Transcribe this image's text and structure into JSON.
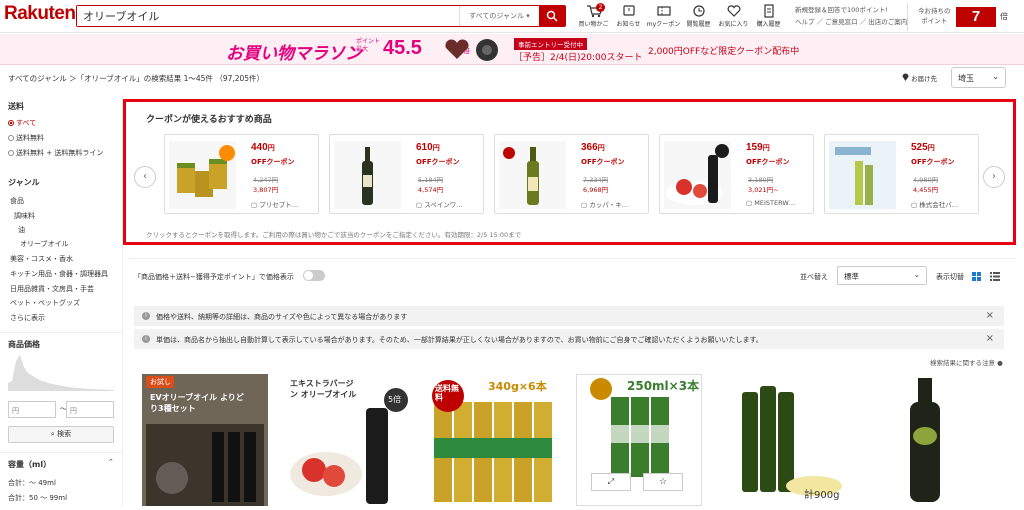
{
  "header": {
    "logo": "Rakuten",
    "search_value": "オリーブオイル",
    "genre_label": "すべてのジャンル",
    "icons": [
      {
        "label": "買い物かご",
        "name": "cart-icon",
        "badge": "2"
      },
      {
        "label": "お知らせ",
        "name": "bell-icon"
      },
      {
        "label": "myクーポン",
        "name": "coupon-icon"
      },
      {
        "label": "閲覧履歴",
        "name": "history-icon"
      },
      {
        "label": "お気に入り",
        "name": "heart-icon"
      },
      {
        "label": "購入履歴",
        "name": "receipt-icon"
      }
    ],
    "links_line1": "新規登録＆回答で100ポイント!",
    "links_line2": "ヘルプ ／ ご意見窓口 ／ 出店のご案内",
    "points_label": "今お持ちの\nポイント",
    "points_value": "7",
    "points_unit": "倍"
  },
  "banner": {
    "title": "お買い物マラソン",
    "pt_label": "ポイント\n最大",
    "pt_value": "45.5",
    "pt_unit": "倍",
    "entry_label": "事前エントリー受付中",
    "schedule": "［予告］2/4(日)20:00スタート",
    "promo": "2,000円OFFなど限定クーポン配布中"
  },
  "breadcrumb": "すべてのジャンル ＞「オリーブオイル」の検索結果 1〜45件 （97,205件）",
  "delivery": {
    "label": "お届け先",
    "value": "埼玉"
  },
  "sidebar": {
    "shipping_title": "送料",
    "shipping_opts": [
      {
        "label": "すべて",
        "on": true
      },
      {
        "label": "送料無料",
        "on": false
      },
      {
        "label": "送料無料 + 送料無料ライン",
        "on": false
      }
    ],
    "genre_title": "ジャンル",
    "genres": [
      "食品",
      "調味料",
      "油",
      "オリーブオイル",
      "美容・コスメ・香水",
      "キッチン用品・食器・調理器具",
      "日用品雑貨・文房具・手芸",
      "ペット・ペットグッズ",
      "さらに表示"
    ],
    "price_title": "商品価格",
    "min_ph": "円",
    "max_ph": "円",
    "tilde": "〜",
    "search_btn": "検索",
    "volume_title": "容量（ml）",
    "volumes": [
      "合計：〜 49ml",
      "合計：50 〜 99ml"
    ]
  },
  "coupon": {
    "title": "クーポンが使えるおすすめ商品",
    "off_label": "OFFクーポン",
    "cards": [
      {
        "amount": "440",
        "unit": "円",
        "was": "4,247円",
        "now": "3,807円",
        "shop": "プリセプト…"
      },
      {
        "amount": "610",
        "unit": "円",
        "was": "5,184円",
        "now": "4,574円",
        "shop": "スペインワ…"
      },
      {
        "amount": "366",
        "unit": "円",
        "was": "7,334円",
        "now": "6,968円",
        "shop": "カッパ・キ…"
      },
      {
        "amount": "159",
        "unit": "円",
        "was": "3,180円",
        "now": "3,021円~",
        "shop": "MEISTERW…"
      },
      {
        "amount": "525",
        "unit": "円",
        "was": "4,980円",
        "now": "4,455円",
        "shop": "株式会社バ…"
      }
    ],
    "note": "クリックするとクーポンを取得します。ご利用の際は買い物かごで該当のクーポンをご指定ください。有効期限：2/5 15:00まで"
  },
  "toolbar": {
    "price_toggle": "「商品価格＋送料−獲得予定ポイント」で価格表示",
    "sort_label": "並べ替え",
    "sort_value": "標準",
    "display_label": "表示切替"
  },
  "notices": [
    "価格や送料、納期等の詳細は、商品のサイズや色によって異なる場合があります",
    "単価は、商品名から抽出し自動計算して表示している場合があります。そのため、一部計算結果が正しくない場合がありますので、お買い物前にご自身でご確認いただくようお願いいたします。"
  ],
  "search_notes": "検索結果に関する注意",
  "products": [
    {
      "tag": "お試し",
      "title": "EVオリーブオイル よりどり3種セット"
    },
    {
      "title": "エキストラバージン オリーブオイル",
      "badge": "5倍"
    },
    {
      "banner": "送料無料",
      "qty": "340g×6本"
    },
    {
      "qty": "250ml×3本"
    },
    {
      "weight": "計900g"
    },
    {}
  ],
  "colors": {
    "brand": "#bf0000",
    "marathon": "#e4007f",
    "highlight": "#e60012"
  }
}
